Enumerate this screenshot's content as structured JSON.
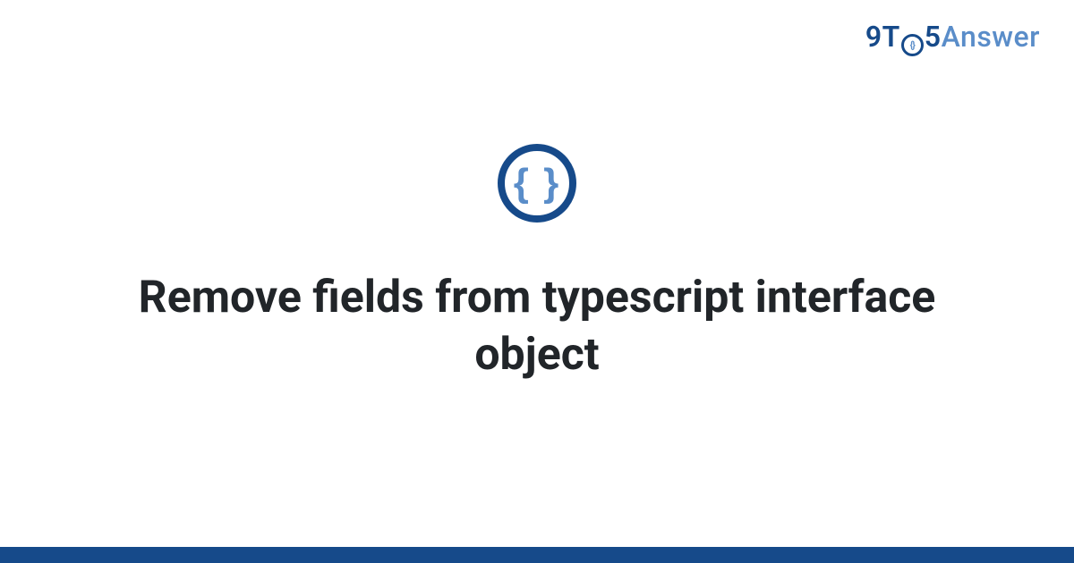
{
  "brand": {
    "prefix": "9T",
    "circle_inner": "{}",
    "suffix": "5",
    "word": "Answer"
  },
  "icon": {
    "glyph": "{ }"
  },
  "title": "Remove fields from typescript interface object"
}
